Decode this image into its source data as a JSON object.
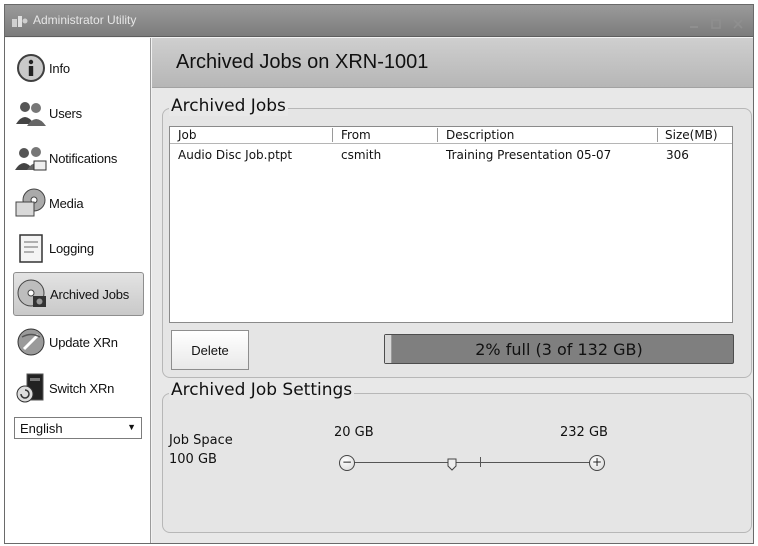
{
  "window": {
    "title": "Administrator Utility"
  },
  "sidebar": {
    "items": [
      {
        "label": "Info",
        "icon": "info-icon",
        "selected": false
      },
      {
        "label": "Users",
        "icon": "users-icon",
        "selected": false
      },
      {
        "label": "Notifications",
        "icon": "notifications-icon",
        "selected": false
      },
      {
        "label": "Media",
        "icon": "media-icon",
        "selected": false
      },
      {
        "label": "Logging",
        "icon": "logging-icon",
        "selected": false
      },
      {
        "label": "Archived Jobs",
        "icon": "archived-jobs-icon",
        "selected": true
      },
      {
        "label": "Update XRn",
        "icon": "update-icon",
        "selected": false
      },
      {
        "label": "Switch XRn",
        "icon": "switch-icon",
        "selected": false
      }
    ],
    "language": {
      "selected": "English"
    }
  },
  "main": {
    "title": "Archived Jobs on XRN-1001",
    "archived_jobs": {
      "legend": "Archived Jobs",
      "columns": [
        "Job",
        "From",
        "Description",
        "Size(MB)"
      ],
      "rows": [
        [
          "Audio Disc Job.ptpt",
          "csmith",
          "Training Presentation 05-07",
          "306"
        ]
      ],
      "delete_label": "Delete",
      "capacity": {
        "text": "2% full (3 of 132 GB)",
        "fraction": 0.02
      }
    },
    "settings": {
      "legend": "Archived Job Settings",
      "job_space_label": "Job Space",
      "job_space_value": "100 GB",
      "min_label": "20 GB",
      "max_label": "232 GB",
      "slider_value_gb": 100,
      "slider_min_gb": 20,
      "slider_max_gb": 232
    }
  },
  "colors": {
    "titlebar": "#8a8a8a",
    "capacity_bar": "#7f7f7f",
    "panel": "#e5e5e5"
  }
}
